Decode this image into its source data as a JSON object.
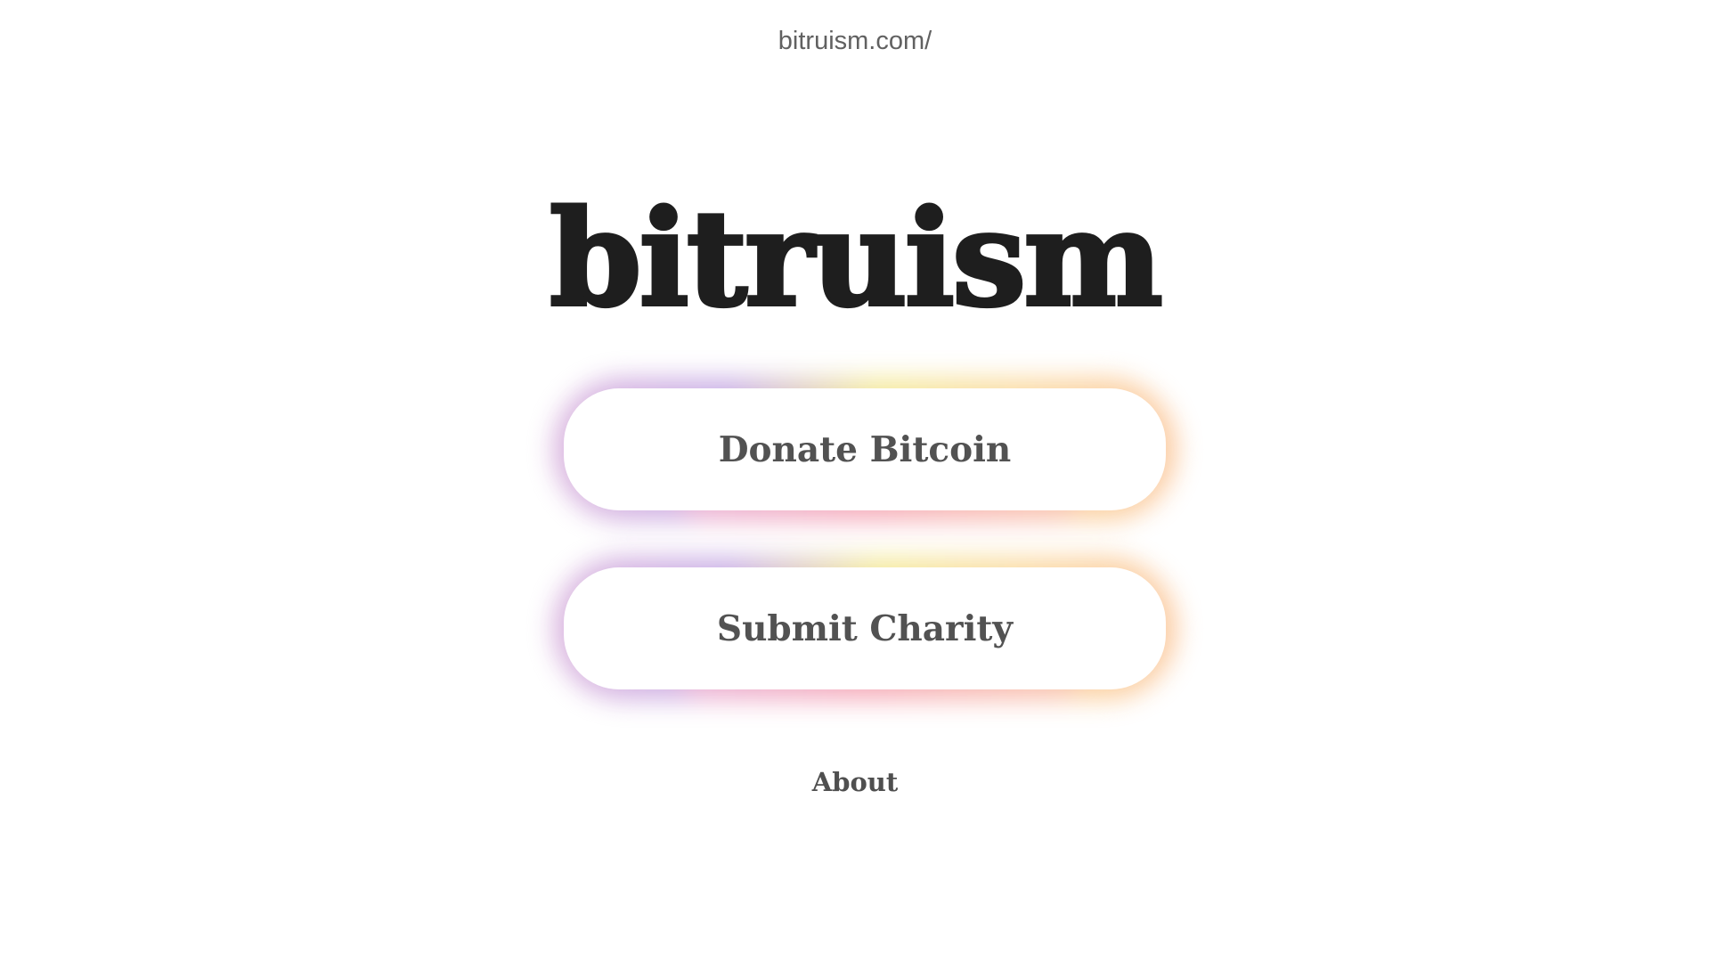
{
  "browser": {
    "url": "bitruism.com/"
  },
  "header": {
    "logo_text": "bitruism"
  },
  "actions": {
    "donate_label": "Donate Bitcoin",
    "submit_label": "Submit Charity"
  },
  "footer": {
    "about_label": "About"
  },
  "colors": {
    "background": "#ffffff",
    "logo": "#1e1e1e",
    "button_text": "#525252",
    "glow_purple": "#c9aee6",
    "glow_yellow": "#f4ea9a",
    "glow_pink": "#f5a8b8",
    "glow_orange": "#fbc79c"
  }
}
